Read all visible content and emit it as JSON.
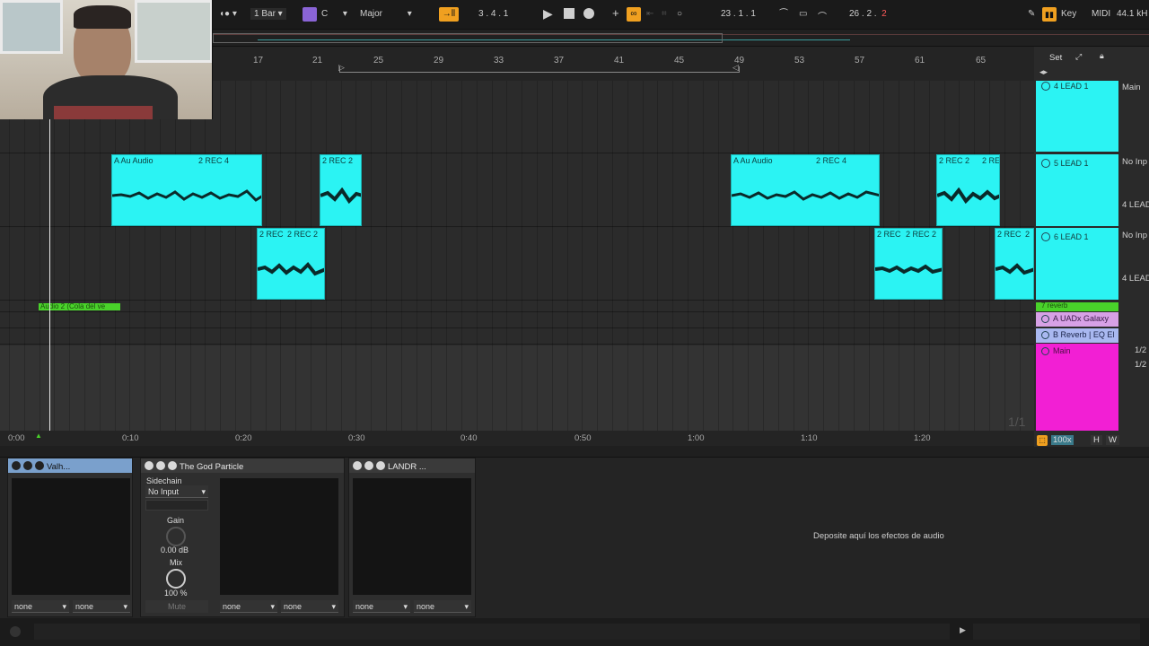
{
  "transport": {
    "quantize": "1 Bar",
    "key_root": "C",
    "scale": "Major",
    "signature": "3 .   4 .   1",
    "position": "23 .   1 .   1",
    "loop_length_a": "26 .   2 .",
    "loop_length_b": "2",
    "key_label": "Key",
    "midi_label": "MIDI",
    "sample_rate": "44.1 kH"
  },
  "ruler": {
    "bars": [
      "17",
      "21",
      "25",
      "29",
      "33",
      "37",
      "41",
      "45",
      "49",
      "53",
      "57",
      "61",
      "65"
    ],
    "set_label": "Set"
  },
  "time_ruler": {
    "times": [
      "0:00",
      "0:10",
      "0:20",
      "0:30",
      "0:40",
      "0:50",
      "1:00",
      "1:10",
      "1:20"
    ],
    "zoom_label": "100x",
    "h_label": "H",
    "w_label": "W",
    "page_counter": "1/1"
  },
  "clips": {
    "lane2": [
      {
        "label": "A Au Audio",
        "label2": "2 REC 4"
      },
      {
        "label": "2 REC 2"
      },
      {
        "label": "A Au Audio",
        "label2": "2 REC 4"
      },
      {
        "label": "2 REC 2",
        "label2": "2 RE"
      }
    ],
    "lane3": [
      {
        "label": "2 REC",
        "label2": "2 REC 2"
      },
      {
        "label": "2 REC",
        "label2": "2 REC 2"
      },
      {
        "label": "2 REC",
        "label2": "2"
      }
    ],
    "green_clip": "Audio 2 (Cola del ve"
  },
  "tracks": [
    {
      "name": "4 LEAD 1",
      "right": "Main"
    },
    {
      "name": "5 LEAD 1",
      "right": "No Inp",
      "right2": "4 LEAD"
    },
    {
      "name": "6 LEAD 1",
      "right": "No Inp",
      "right2": "4 LEAD"
    },
    {
      "name": "7 reverb",
      "right": ""
    },
    {
      "name": "A UADx Galaxy",
      "right": ""
    },
    {
      "name": "B Reverb | EQ El",
      "right": "1/2"
    },
    {
      "name": "Main",
      "right": "1/2"
    }
  ],
  "devices": [
    {
      "title": "Valh...",
      "sel1": "none",
      "sel2": "none"
    },
    {
      "title": "The God Particle",
      "sidechain": "Sidechain",
      "input": "No Input",
      "gain_label": "Gain",
      "gain_value": "0.00 dB",
      "mix_label": "Mix",
      "mix_value": "100 %",
      "mute": "Mute"
    },
    {
      "title": "",
      "sel1": "none",
      "sel2": "none"
    },
    {
      "title": "LANDR ...",
      "sel1": "none",
      "sel2": "none"
    }
  ],
  "drop_hint": "Deposite aquí los efectos de audio",
  "colors": {
    "clip": "#2bf3f3",
    "master": "#f21fd4",
    "green": "#49d22a",
    "return_a": "#d7a1e6",
    "return_b": "#a9b8f0"
  }
}
